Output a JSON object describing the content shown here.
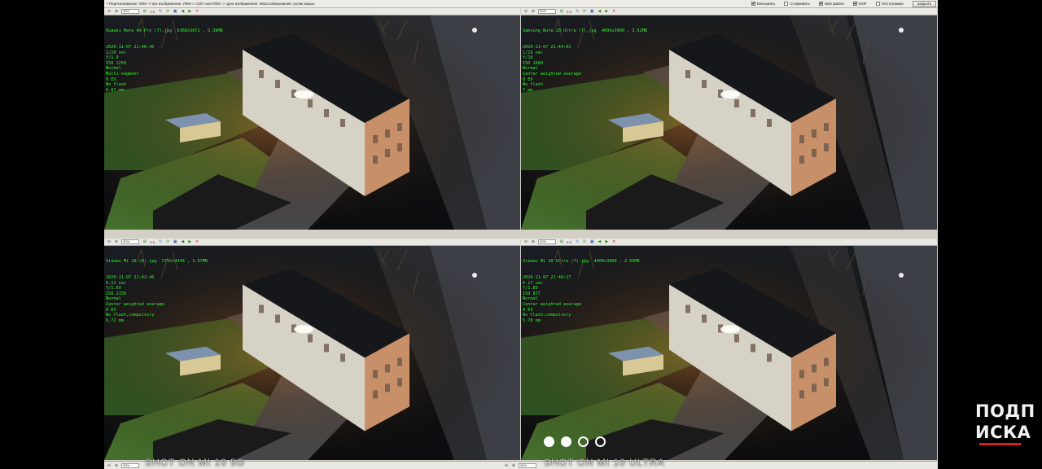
{
  "topbar": {
    "hint": "• Перетаскивание: ЛКМ -> все изображения, ЛКМ с «Ctrl» или ПКМ -> одно изображение. Масштабирование: ролик мыши.",
    "options": [
      {
        "label": "Вписывать",
        "checked": true
      },
      {
        "label": "Сглаживать",
        "checked": false
      },
      {
        "label": "Имя файла",
        "checked": true
      },
      {
        "label": "EXIF",
        "checked": true
      },
      {
        "label": "Гистограмма",
        "checked": false
      }
    ],
    "close_label": "Закрыть"
  },
  "pane_toolbar": {
    "zoom": "30%",
    "ratio": "1:1",
    "icons": [
      "zoom-out-icon",
      "zoom-in-icon",
      "fit-icon",
      "rotate-icon",
      "refresh-icon",
      "save-icon",
      "prev-icon",
      "next-icon",
      "close-icon"
    ]
  },
  "panes": [
    {
      "filename": "Huawei Mate 40 Pro (7).jpg",
      "size": "6368x3072",
      "filesize": "5.39MB",
      "exif": [
        "2020-11-07 21:46:45",
        "1/20 sec",
        "f/1.9",
        "ISO 1250",
        "Normal",
        "Multi-segment",
        "0 EV",
        "No flash",
        "6.67 mm"
      ]
    },
    {
      "filename": "Samsung Note 20 Ultra (7).jpg",
      "size": "4000x3000",
      "filesize": "3.62MB",
      "exif": [
        "2020-11-07 21:44:03",
        "1/19 sec",
        "f/18",
        "ISO 1600",
        "Normal",
        "Center weighted average",
        "0 EV",
        "No flash",
        "7 mm"
      ]
    },
    {
      "filename": "Xiaomi Mi 10 (8).jpg",
      "size": "5792x4344",
      "filesize": "1.97MB",
      "exif": [
        "2020-11-07 21:42:46",
        "0.11 sec",
        "f/1.69",
        "ISO 2158",
        "Normal",
        "Center weighted average",
        "0 EV",
        "No flash,compulsory",
        "6.72 mm"
      ]
    },
    {
      "filename": "Xiaomi Mi 10 Ultra (7).jpg",
      "size": "4000x3000",
      "filesize": "2.65MB",
      "exif": [
        "2020-11-07 21:48:27",
        "0.17 sec",
        "f/1.89",
        "ISO 877",
        "Normal",
        "Center weighted average",
        "0 EV",
        "No flash,compulsory",
        "5.78 mm"
      ]
    }
  ],
  "overlays": {
    "left": "SHOT ON MI 10 5G",
    "right": "SHOT ON MI 10 ULTRA"
  },
  "carousel": {
    "count": 4,
    "active": 2
  },
  "logo": {
    "line1": "ПОДП",
    "line2": "ИСКА"
  },
  "colors": {
    "exif_text": "#3cff3c",
    "logo_accent": "#d21e24"
  }
}
